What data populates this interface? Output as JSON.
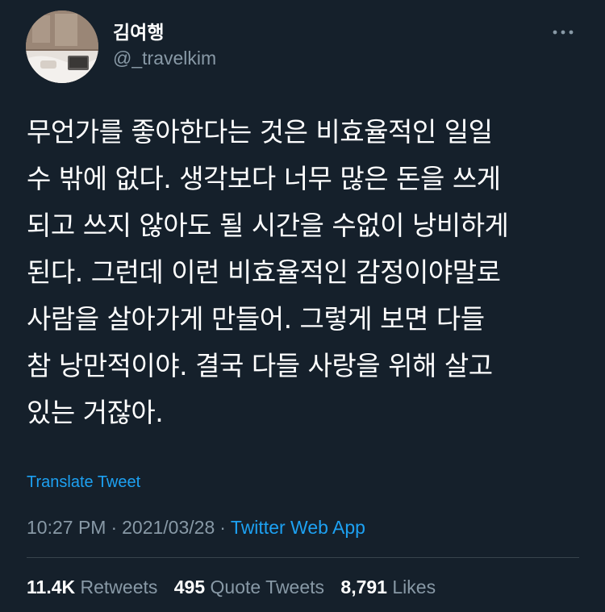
{
  "user": {
    "display_name": "김여행",
    "handle": "@_travelkim"
  },
  "header": {
    "more_icon": "more-horizontal-icon"
  },
  "tweet": {
    "lines": [
      "무언가를 좋아한다는 것은 비효율적인 일일",
      "수 밖에 없다. 생각보다 너무 많은 돈을 쓰게",
      "되고 쓰지 않아도 될 시간을 수없이 낭비하게",
      "된다. 그런데 이런 비효율적인 감정이야말로",
      "사람을 살아가게 만들어. 그렇게 보면 다들",
      "참 낭만적이야. 결국 다들 사랑을 위해 살고",
      "있는 거잖아."
    ],
    "translate_label": "Translate Tweet"
  },
  "meta": {
    "time": "10:27 PM",
    "separator": "·",
    "date": "2021/03/28",
    "source": "Twitter Web App"
  },
  "stats": {
    "retweets_count": "11.4K",
    "retweets_label": "Retweets",
    "quote_count": "495",
    "quote_label": "Quote Tweets",
    "likes_count": "8,791",
    "likes_label": "Likes"
  },
  "colors": {
    "background": "#15202b",
    "text_primary": "#ffffff",
    "text_secondary": "#8899a6",
    "accent": "#1da1f2",
    "divider": "#38444d"
  }
}
